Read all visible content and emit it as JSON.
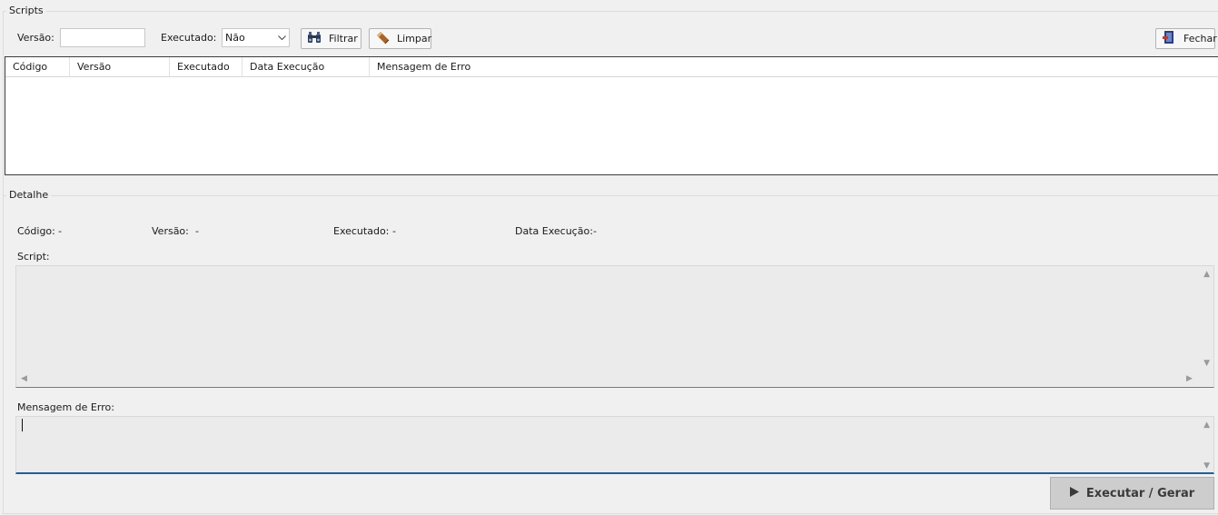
{
  "scripts_group": {
    "title": "Scripts",
    "versao_label": "Versão:",
    "versao_value": "",
    "executado_label": "Executado:",
    "executado_selected": "Não",
    "filtrar_label": "Filtrar",
    "limpar_label": "Limpar",
    "fechar_label": "Fechar",
    "columns": [
      "Código",
      "Versão",
      "Executado",
      "Data Execução",
      "Mensagem de Erro"
    ],
    "rows": []
  },
  "detalhe_group": {
    "title": "Detalhe",
    "codigo_label": "Código:",
    "codigo_value": "-",
    "versao_label": "Versão:",
    "versao_value": "-",
    "executado_label": "Executado:",
    "executado_value": "-",
    "data_execucao_label": "Data Execução:",
    "data_execucao_value": "-",
    "script_label": "Script:",
    "script_value": "",
    "mensagem_erro_label": "Mensagem de Erro:",
    "mensagem_erro_value": ""
  },
  "footer": {
    "executar_label": "Executar / Gerar"
  },
  "icons": {
    "filtrar": "binoculars-icon",
    "limpar": "eraser-icon",
    "fechar": "exit-door-icon",
    "executar": "play-icon"
  },
  "colors": {
    "background": "#f0f0f0",
    "accent_focus": "#1f5f9e",
    "disabled_button": "#cdcdcd"
  }
}
